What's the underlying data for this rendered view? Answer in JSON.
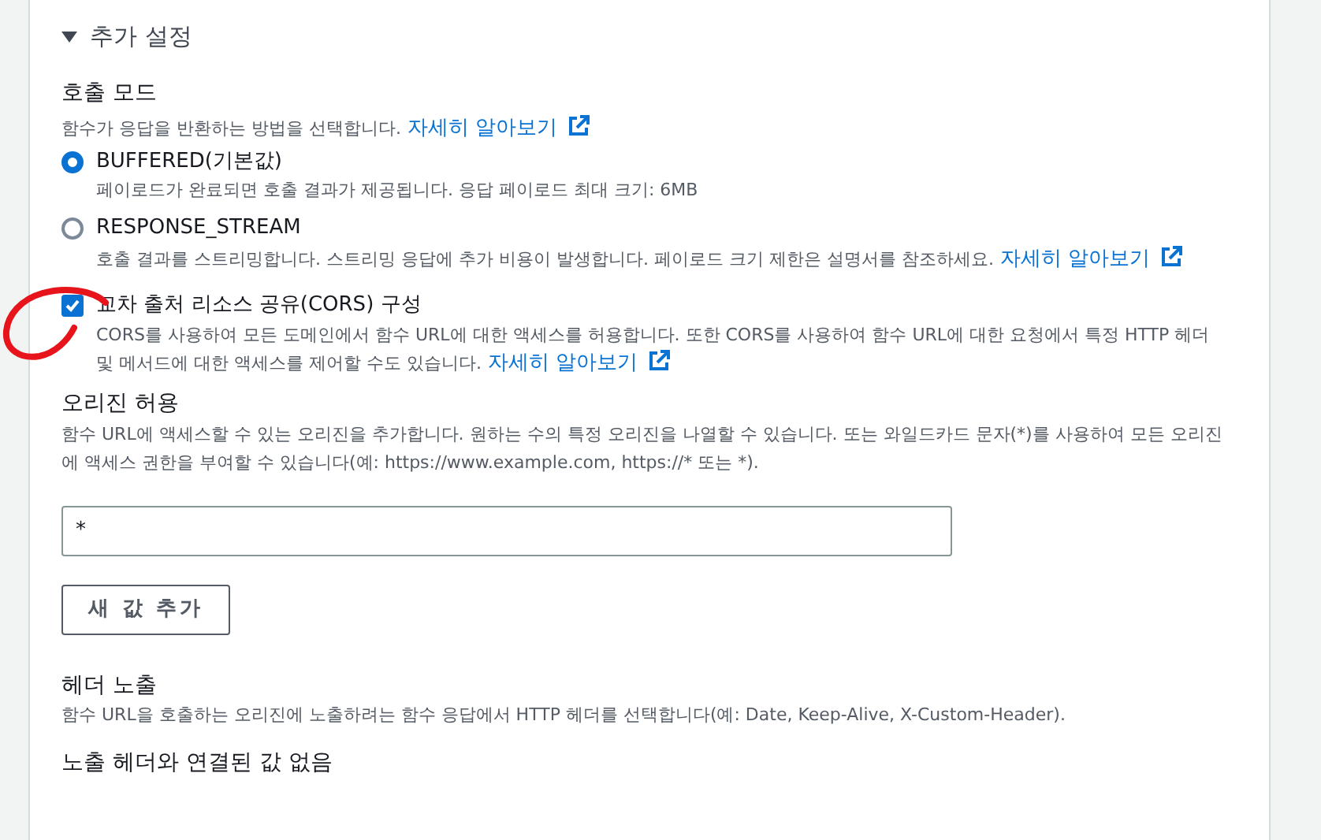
{
  "section": {
    "title": "추가 설정",
    "expanded": true
  },
  "invoke_mode": {
    "label": "호출 모드",
    "description": "함수가 응답을 반환하는 방법을 선택합니다.",
    "link": "자세히 알아보기",
    "options": [
      {
        "label": "BUFFERED(기본값)",
        "description": "페이로드가 완료되면 호출 결과가 제공됩니다. 응답 페이로드 최대 크기: 6MB",
        "selected": true
      },
      {
        "label": "RESPONSE_STREAM",
        "description": "호출 결과를 스트리밍합니다. 스트리밍 응답에 추가 비용이 발생합니다. 페이로드 크기 제한은 설명서를 참조하세요.",
        "link": "자세히 알아보기",
        "selected": false
      }
    ]
  },
  "cors": {
    "label": "교차 출처 리소스 공유(CORS) 구성",
    "checked": true,
    "description": "CORS를 사용하여 모든 도메인에서 함수 URL에 대한 액세스를 허용합니다. 또한 CORS를 사용하여 함수 URL에 대한 요청에서 특정 HTTP 헤더 및 메서드에 대한 액세스를 제어할 수도 있습니다.",
    "link": "자세히 알아보기"
  },
  "allow_origin": {
    "label": "오리진 허용",
    "description": "함수 URL에 액세스할 수 있는 오리진을 추가합니다. 원하는 수의 특정 오리진을 나열할 수 있습니다. 또는 와일드카드 문자(*)를 사용하여 모든 오리진에 액세스 권한을 부여할 수 있습니다(예: https://www.example.com, https://* 또는 *).",
    "values": [
      "*"
    ],
    "add_button": "새 값 추가"
  },
  "expose_headers": {
    "label": "헤더 노출",
    "description": "함수 URL을 호출하는 오리진에 노출하려는 함수 응답에서 HTTP 헤더를 선택합니다(예: Date, Keep-Alive, X-Custom-Header).",
    "empty": "노출 헤더와 연결된 값 없음"
  }
}
